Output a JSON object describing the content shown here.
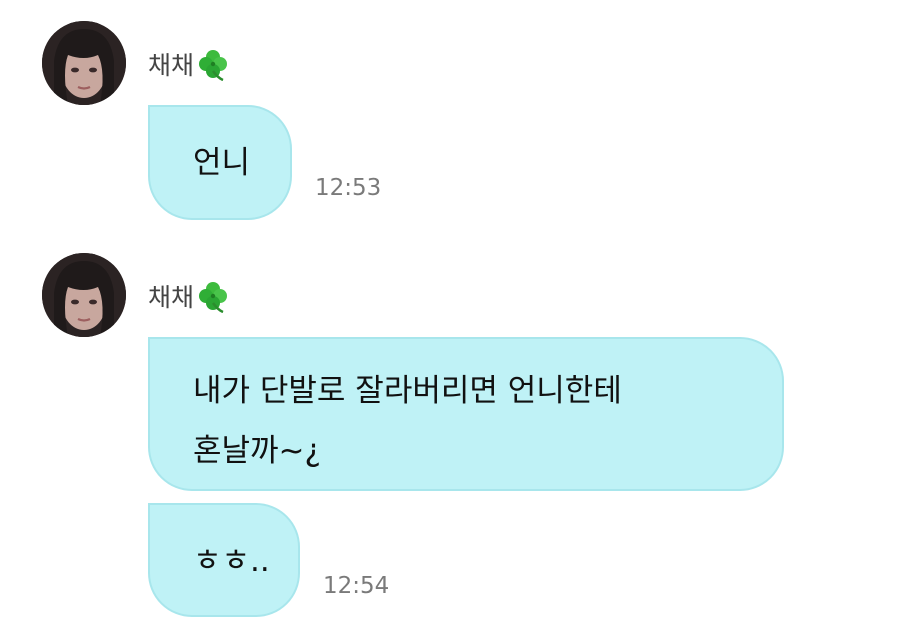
{
  "messages": [
    {
      "sender": "채채",
      "sender_emoji": "🍀",
      "bubbles": [
        {
          "text": "언니",
          "time": "12:53"
        }
      ]
    },
    {
      "sender": "채채",
      "sender_emoji": "🍀",
      "bubbles": [
        {
          "text_line1": "내가 단발로 잘라버리면 언니한테",
          "text_line2": "혼날까~¿"
        },
        {
          "text": "ㅎㅎ..",
          "time": "12:54"
        }
      ]
    }
  ],
  "colors": {
    "bubble_bg": "#bff2f6",
    "bubble_border": "#a8e6ec",
    "time_text": "#7a7a7a",
    "sender_text": "#444444"
  },
  "icons": {
    "avatar": "profile-photo",
    "clover": "four-leaf-clover-icon"
  }
}
